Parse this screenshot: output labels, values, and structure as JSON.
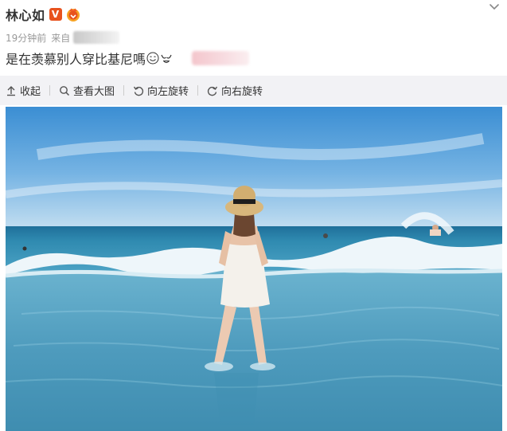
{
  "post": {
    "author_name": "林心如",
    "verified_mark": "V",
    "time": "19分钟前",
    "from_label": "来自",
    "text": "是在羡慕别人穿比基尼嗎"
  },
  "toolbar": {
    "collapse_label": "收起",
    "view_large_label": "查看大图",
    "rotate_left_label": "向左旋转",
    "rotate_right_label": "向右旋转"
  },
  "icons": {
    "vip": "vip-crown-icon",
    "more": "chevron-down-icon",
    "collapse": "collapse-arrow-icon",
    "view_large": "magnifier-icon",
    "rotate_left": "rotate-left-icon",
    "rotate_right": "rotate-right-icon",
    "emoji_1": "smile-emoji-icon",
    "emoji_2": "bikini-emoji-icon"
  },
  "colors": {
    "verified_badge": "#e8521d",
    "toolbar_bg": "#f2f2f5",
    "meta_text": "#999999",
    "primary_text": "#333333"
  }
}
